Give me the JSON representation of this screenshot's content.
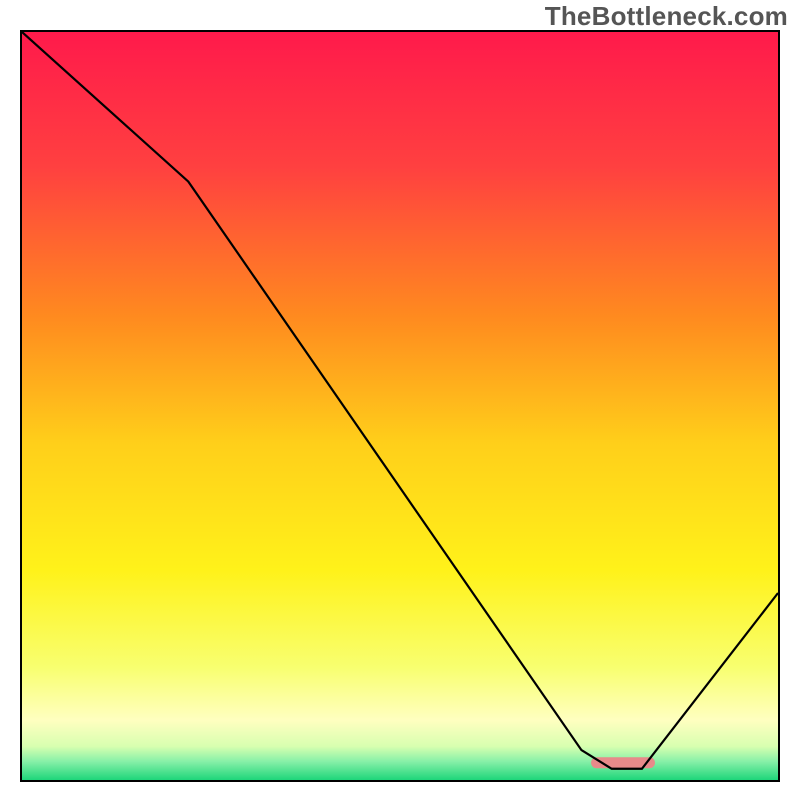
{
  "watermark": "TheBottleneck.com",
  "chart_data": {
    "type": "line",
    "title": "",
    "xlabel": "",
    "ylabel": "",
    "xlim": [
      0,
      100
    ],
    "ylim": [
      0,
      100
    ],
    "x": [
      0,
      22,
      74,
      78,
      82,
      100
    ],
    "y": [
      100,
      80,
      4,
      1.5,
      1.5,
      25
    ],
    "series": [
      {
        "name": "curve",
        "x": [
          0,
          22,
          74,
          78,
          82,
          100
        ],
        "y": [
          100,
          80,
          4,
          1.5,
          1.5,
          25
        ]
      }
    ],
    "marker": {
      "x_start": 76,
      "x_end": 83,
      "y": 2.3,
      "color": "#e78a8a"
    },
    "background_gradient": {
      "stops": [
        {
          "offset": 0.0,
          "color": "#ff1a4b"
        },
        {
          "offset": 0.18,
          "color": "#ff4040"
        },
        {
          "offset": 0.38,
          "color": "#ff8a1f"
        },
        {
          "offset": 0.55,
          "color": "#ffcf1a"
        },
        {
          "offset": 0.72,
          "color": "#fff21a"
        },
        {
          "offset": 0.85,
          "color": "#f8ff70"
        },
        {
          "offset": 0.92,
          "color": "#ffffc0"
        },
        {
          "offset": 0.955,
          "color": "#d8ffb0"
        },
        {
          "offset": 0.975,
          "color": "#88f0a8"
        },
        {
          "offset": 1.0,
          "color": "#1ed67a"
        }
      ]
    }
  }
}
